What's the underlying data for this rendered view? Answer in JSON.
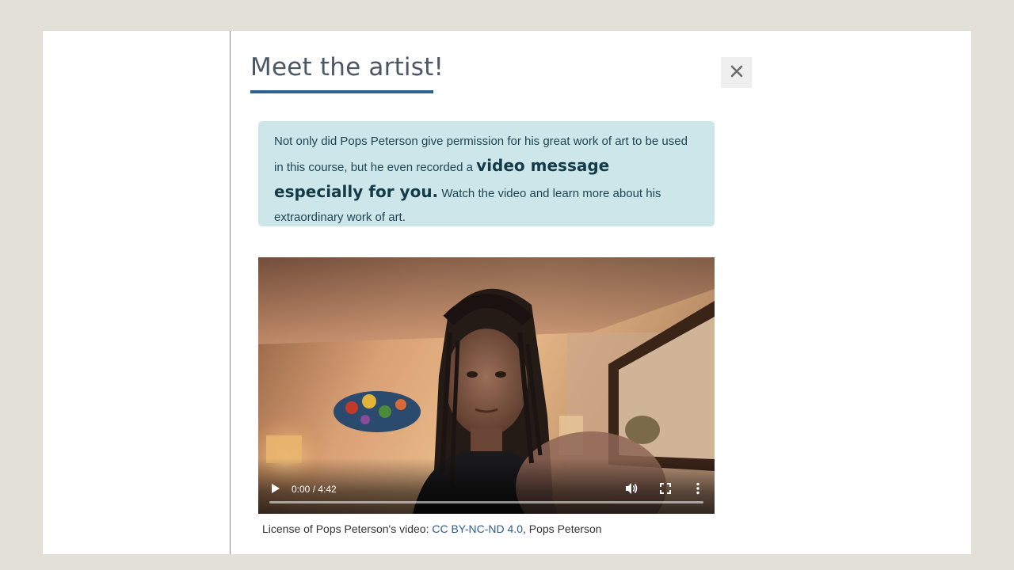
{
  "panel": {
    "title": "Meet the artist!",
    "close_icon": "close-icon"
  },
  "callout": {
    "text_before": "Not only did Pops Peterson give permission for his great work of art to be used in this course, but he even recorded a ",
    "emphasis": "video message especially for you.",
    "text_after": " Watch the video and learn more about his extraordinary work of art."
  },
  "video": {
    "time": "0:00 / 4:42",
    "progress": 0,
    "icons": [
      "play-icon",
      "volume-icon",
      "fullscreen-icon",
      "more-options-icon"
    ]
  },
  "license": {
    "prefix": "License of Pops Peterson's video: ",
    "link_text": "CC BY-NC-ND 4.0",
    "suffix": ", Pops Peterson"
  },
  "colors": {
    "background": "#e3e0d8",
    "title_underline": "#2e5f8e",
    "callout_bg": "#cde6e9",
    "link": "#2d5c8c"
  }
}
